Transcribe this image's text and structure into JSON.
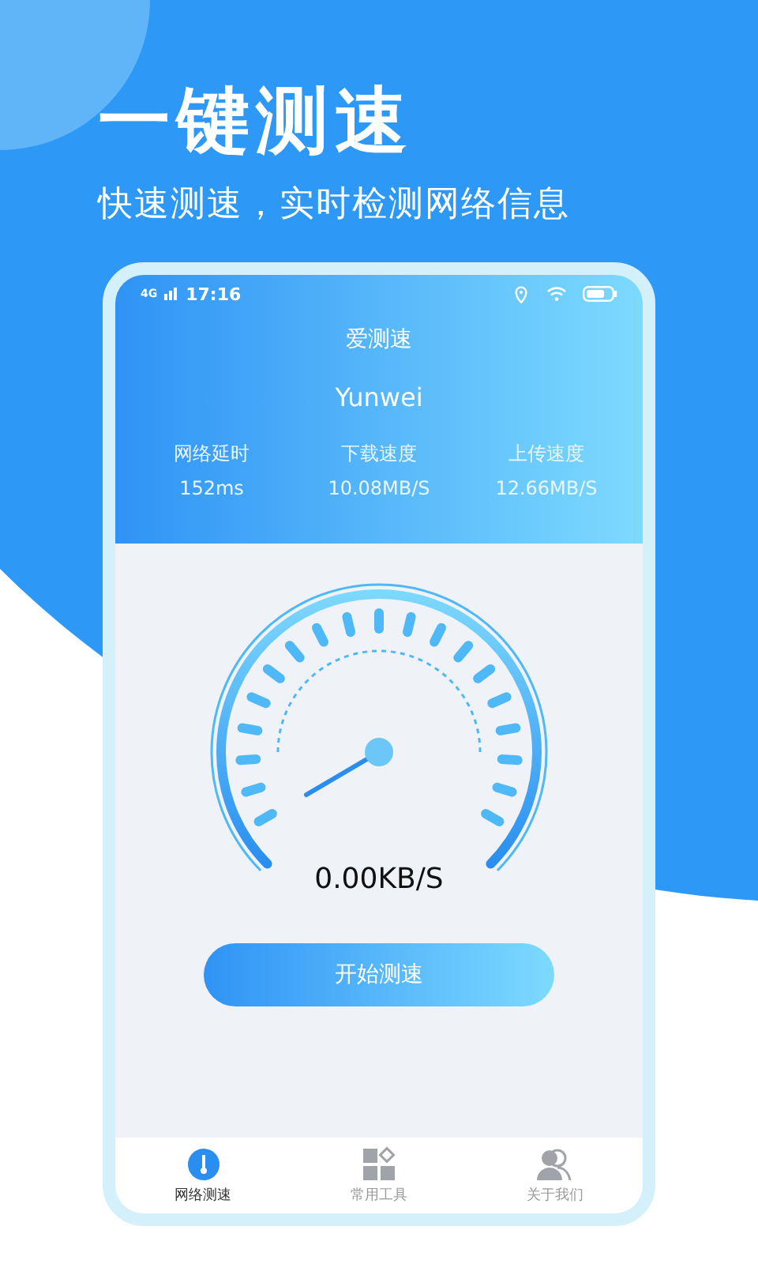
{
  "headline": "一键测速",
  "subtitle": "快速测速，实时检测网络信息",
  "status_bar": {
    "network": "4G",
    "time": "17:16"
  },
  "app_title": "爱测速",
  "network_name": "Yunwei",
  "stats": [
    {
      "label": "网络延时",
      "value": "152ms"
    },
    {
      "label": "下载速度",
      "value": "10.08MB/S"
    },
    {
      "label": "上传速度",
      "value": "12.66MB/S"
    }
  ],
  "speed_reading": "0.00KB/S",
  "start_button": "开始测速",
  "tabs": [
    {
      "label": "网络测速",
      "kind": "gauge",
      "selected": true
    },
    {
      "label": "常用工具",
      "kind": "tools",
      "selected": false
    },
    {
      "label": "关于我们",
      "kind": "people",
      "selected": false
    }
  ]
}
